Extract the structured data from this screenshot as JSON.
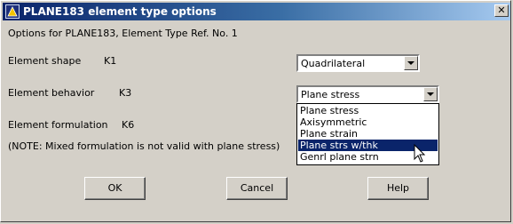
{
  "window": {
    "title": "PLANE183 element type options"
  },
  "header": {
    "options_text": "Options for PLANE183, Element Type Ref. No. 1"
  },
  "fields": {
    "shape": {
      "label": "Element shape",
      "key": "K1",
      "value": "Quadrilateral"
    },
    "behavior": {
      "label": "Element behavior",
      "key": "K3",
      "value": "Plane stress",
      "options": [
        "Plane stress",
        "Axisymmetric",
        "Plane strain",
        "Plane strs w/thk",
        "Genrl plane strn"
      ],
      "highlighted_option": "Plane strs w/thk"
    },
    "formulation": {
      "label": "Element formulation",
      "key": "K6"
    }
  },
  "note": "(NOTE: Mixed formulation is not valid with plane stress)",
  "buttons": {
    "ok": "OK",
    "cancel": "Cancel",
    "help": "Help"
  },
  "colors": {
    "titlebar_start": "#0a246a",
    "titlebar_end": "#a6caf0",
    "selection": "#0a246a",
    "face": "#d4d0c8"
  },
  "icons": {
    "app": "ansys-app-icon",
    "close": "close-icon",
    "dropdown": "chevron-down-icon",
    "cursor": "mouse-pointer-icon"
  }
}
